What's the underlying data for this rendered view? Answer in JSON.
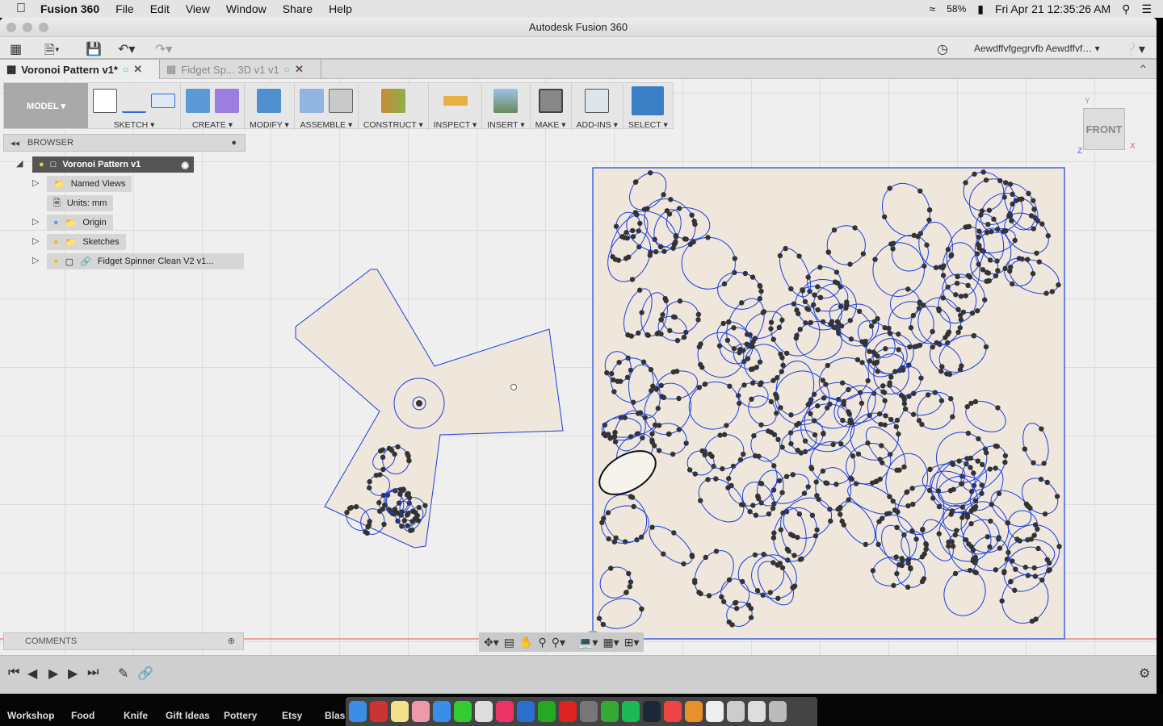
{
  "menubar": {
    "app": "Fusion 360",
    "items": [
      "File",
      "Edit",
      "View",
      "Window",
      "Share",
      "Help"
    ],
    "battery": "58%",
    "clock": "Fri Apr 21  12:35:26 AM"
  },
  "window": {
    "title": "Autodesk Fusion 360",
    "user": "Aewdffvfgegrvfb Aewdffvf… ▾"
  },
  "tabs": [
    {
      "label": "Voronoi Pattern v1*"
    },
    {
      "label": "Fidget Sp... 3D v1 v1"
    }
  ],
  "ribbon": {
    "mode": "MODEL ▾",
    "groups": [
      "SKETCH ▾",
      "CREATE ▾",
      "MODIFY ▾",
      "ASSEMBLE ▾",
      "CONSTRUCT ▾",
      "INSPECT ▾",
      "INSERT ▾",
      "MAKE ▾",
      "ADD-INS ▾",
      "SELECT ▾"
    ]
  },
  "browser": {
    "title": "BROWSER",
    "root": "Voronoi Pattern v1",
    "items": [
      "Named Views",
      "Units: mm",
      "Origin",
      "Sketches",
      "Fidget Spinner Clean V2 v1..."
    ]
  },
  "comments": {
    "title": "COMMENTS"
  },
  "viewcube": {
    "face": "FRONT",
    "x": "X",
    "y": "Y",
    "z": "Z"
  },
  "bookmarks": [
    "Workshop",
    "Food",
    "Knife",
    "Gift Ideas",
    "Pottery",
    "Etsy",
    "Blas"
  ],
  "colors": {
    "sketch_line": "#1a3fe0",
    "profile_fill": "#efe6dc",
    "axis_red": "#e05050",
    "select_blue": "#3a7fc4"
  }
}
